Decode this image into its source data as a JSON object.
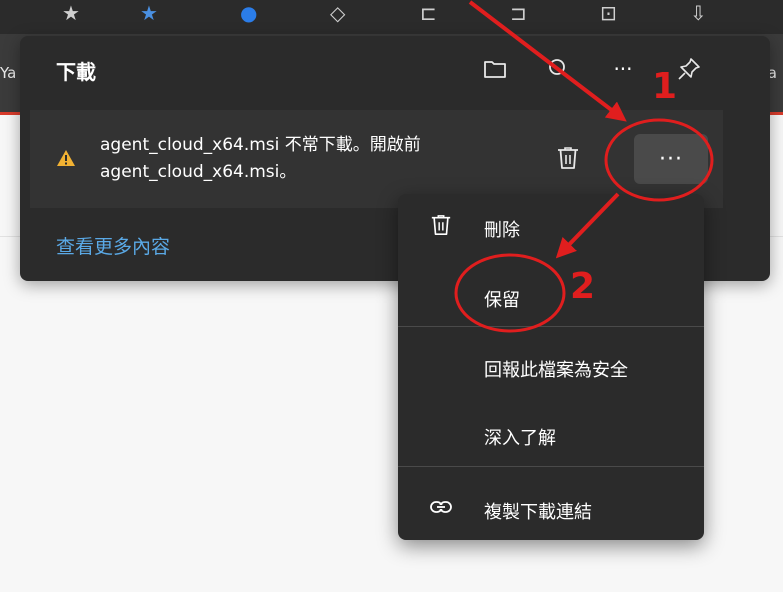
{
  "browser": {
    "bookmark_left_fragment": "Ya",
    "bookmark_right_fragment": "Ana"
  },
  "downloads": {
    "title": "下載",
    "header_icons": [
      "folder-icon",
      "search-icon",
      "more-options-icon",
      "pin-icon"
    ],
    "header_more_glyph": "···",
    "item": {
      "warning_icon": "warning-icon",
      "message_line1": "agent_cloud_x64.msi 不常下載。開啟前",
      "message_line2": "agent_cloud_x64.msi。",
      "more_glyph": "···"
    },
    "see_more": "查看更多內容"
  },
  "context_menu": {
    "items": [
      {
        "label": "刪除",
        "icon": "trash-icon"
      },
      {
        "label": "保留",
        "icon": ""
      },
      {
        "label": "回報此檔案為安全",
        "icon": ""
      },
      {
        "label": "深入了解",
        "icon": ""
      },
      {
        "label": "複製下載連結",
        "icon": "link-icon"
      }
    ]
  },
  "annotations": {
    "step1": "1",
    "step2": "2",
    "color": "#e01e1e"
  },
  "colors": {
    "panel_bg": "#2b2b2b",
    "item_bg": "#333333",
    "accent_link": "#5aa9e6",
    "warning": "#f2b233"
  }
}
